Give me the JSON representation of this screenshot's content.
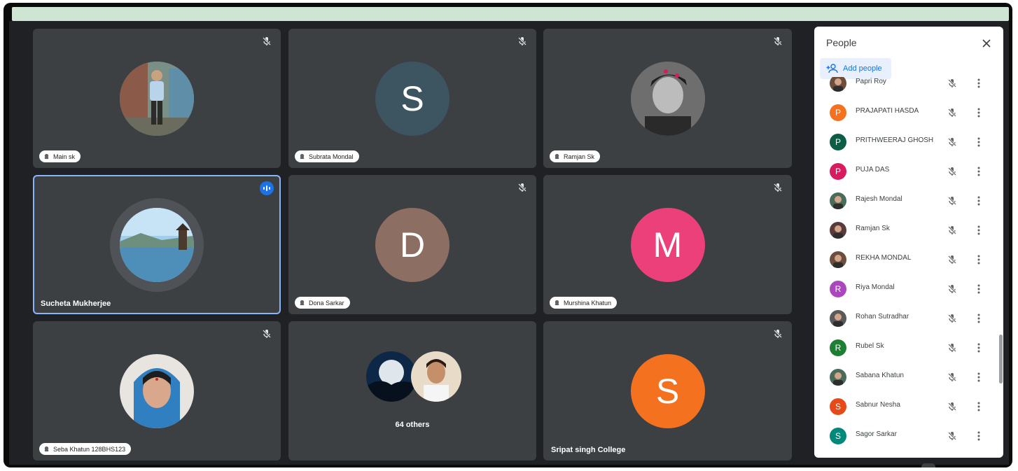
{
  "tiles": [
    {
      "name": "Main sk",
      "avatar": "photo-person-standing",
      "muted": true
    },
    {
      "name": "Subrata Mondal",
      "letter": "S",
      "color": "#3d5461",
      "muted": true
    },
    {
      "name": "Ramjan Sk",
      "avatar": "photo-bw-portrait",
      "muted": true
    },
    {
      "name": "Sucheta Mukherjee",
      "avatar": "photo-lake",
      "speaking": true
    },
    {
      "name": "Dona Sarkar",
      "letter": "D",
      "color": "#8d6e63",
      "muted": true
    },
    {
      "name": "Murshina Khatun",
      "letter": "M",
      "color": "#ec407a",
      "muted": true
    },
    {
      "name": "Seba Khatun 128BHS123",
      "avatar": "photo-woman-portrait",
      "muted": true
    },
    {
      "others_label": "64 others"
    },
    {
      "name": "Sripat singh College",
      "letter": "S",
      "color": "#f4711f",
      "muted": true
    }
  ],
  "people_panel": {
    "title": "People",
    "add_label": "Add people",
    "participants": [
      {
        "name": "Papri Roy",
        "avatar": "photo"
      },
      {
        "name": "PRAJAPATI HASDA",
        "letter": "P",
        "color": "#f4711f"
      },
      {
        "name": "PRITHWEERAJ GHOSH",
        "letter": "P",
        "color": "#0b5e45"
      },
      {
        "name": "PUJA DAS",
        "letter": "P",
        "color": "#d81b60"
      },
      {
        "name": "Rajesh Mondal",
        "avatar": "photo"
      },
      {
        "name": "Ramjan Sk",
        "avatar": "photo"
      },
      {
        "name": "REKHA MONDAL",
        "avatar": "photo"
      },
      {
        "name": "Riya Mondal",
        "letter": "R",
        "color": "#ab47bc"
      },
      {
        "name": "Rohan Sutradhar",
        "avatar": "photo"
      },
      {
        "name": "Rubel Sk",
        "letter": "R",
        "color": "#1e7e34"
      },
      {
        "name": "Sabana Khatun",
        "avatar": "photo"
      },
      {
        "name": "Sabnur Nesha",
        "letter": "S",
        "color": "#e64a19"
      },
      {
        "name": "Sagor Sarkar",
        "letter": "S",
        "color": "#00897b"
      }
    ]
  }
}
